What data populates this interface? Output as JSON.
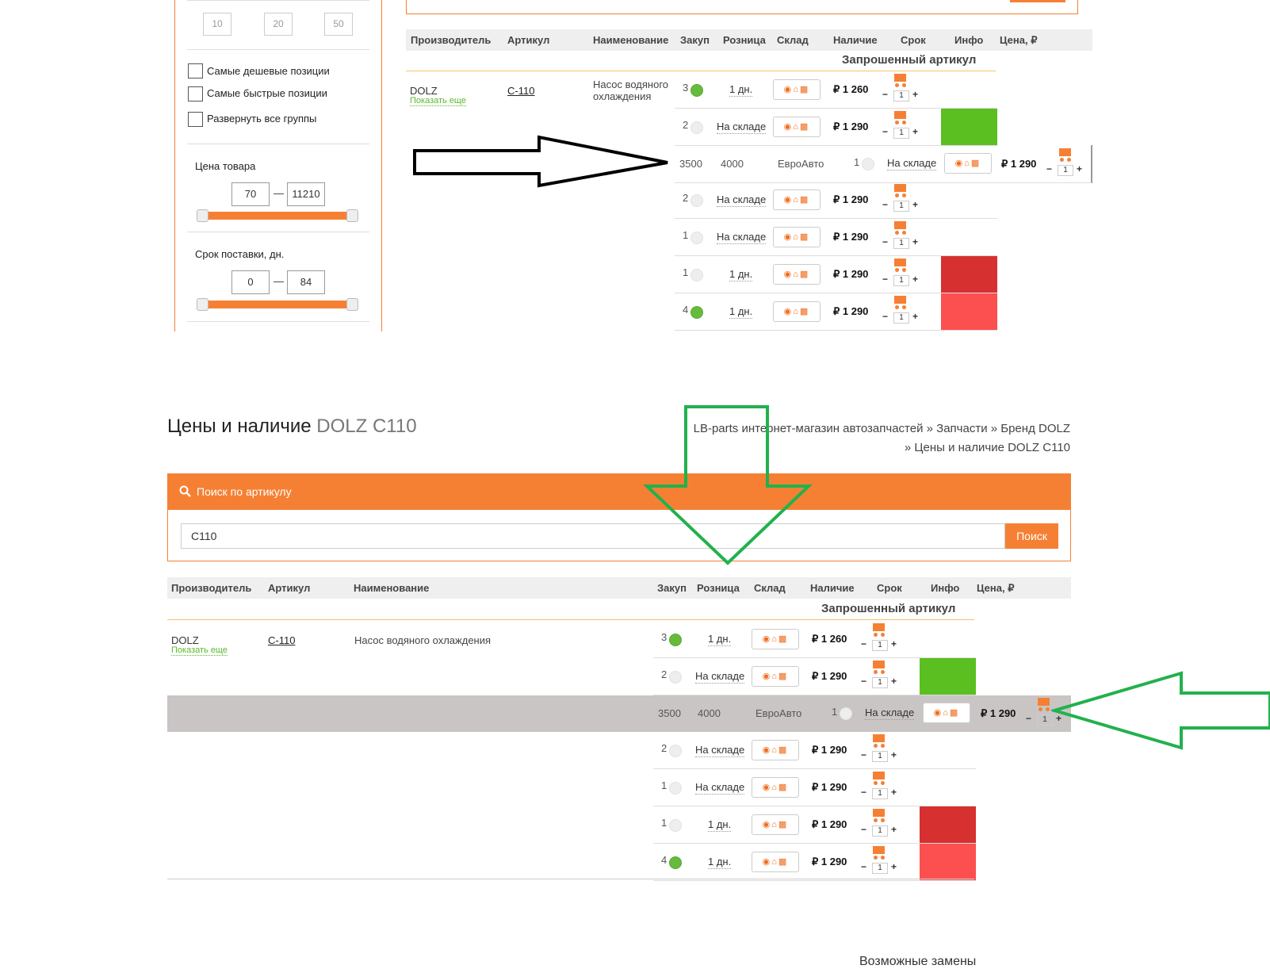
{
  "sidebar": {
    "per_page": [
      "10",
      "20",
      "50"
    ],
    "checkboxes": [
      "Самые дешевые позиции",
      "Самые быстрые позиции",
      "Развернуть все группы"
    ],
    "price": {
      "title": "Цена товара",
      "from": "70",
      "to": "11210"
    },
    "delivery": {
      "title": "Срок поставки, дн.",
      "from": "0",
      "to": "84"
    },
    "dash": "—"
  },
  "table": {
    "columns_top": [
      "Производитель",
      "Артикул",
      "Наименование",
      "Закуп",
      "Розница",
      "Склад",
      "Наличие",
      "Срок",
      "Инфо",
      "Цена, ₽"
    ],
    "columns_bottom": [
      "Производитель",
      "Артикул",
      "Наименование",
      "Закуп",
      "Розница",
      "Склад",
      "Наличие",
      "Срок",
      "Инфо",
      "Цена, ₽"
    ],
    "requested_title": "Запрошенный артикул",
    "manufacturer": "DOLZ",
    "show_more": "Показать еще",
    "article": "C-110",
    "name": "Насос водяного охлаждения",
    "rows": [
      {
        "qty": "3",
        "dot": "green",
        "delivery": "1 дн.",
        "price": "₽ 1 260",
        "count": "1",
        "color": ""
      },
      {
        "qty": "2",
        "dot": "grey",
        "delivery": "На складе",
        "price": "₽ 1 290",
        "count": "1",
        "color": "#5bbf21"
      },
      {
        "qty": "2",
        "dot": "grey",
        "delivery": "На складе",
        "price": "₽ 1 290",
        "count": "1",
        "color": ""
      },
      {
        "qty": "1",
        "dot": "grey",
        "delivery": "На складе",
        "price": "₽ 1 290",
        "count": "1",
        "color": ""
      },
      {
        "qty": "1",
        "dot": "grey",
        "delivery": "1 дн.",
        "price": "₽ 1 290",
        "count": "1",
        "color": "#d63031"
      },
      {
        "qty": "4",
        "dot": "green",
        "delivery": "1 дн.",
        "price": "₽ 1 290",
        "count": "1",
        "color": "#fc4f4f"
      }
    ],
    "highlight_row": {
      "buy": "3500",
      "retail": "4000",
      "warehouse": "ЕвроАвто",
      "qty": "1",
      "delivery": "На складе",
      "price": "₽ 1 290",
      "count": "1"
    }
  },
  "page": {
    "title_main": "Цены и наличие",
    "title_brand": "DOLZ C110",
    "breadcrumb_line1": "LB-parts интернет-магазин автозапчастей » Запчасти » Бренд DOLZ",
    "breadcrumb_line2": "» Цены и наличие DOLZ C110",
    "search_title": "Поиск по артикулу",
    "search_value": "C110",
    "search_button": "Поиск",
    "replacements_title": "Возможные замены"
  },
  "stepper": {
    "minus": "−",
    "plus": "+"
  },
  "colors": {
    "accent": "#f58034",
    "green_marker": "#5bbf21",
    "red_marker": "#d63031",
    "light_red_marker": "#fc4f4f",
    "highlight_bg": "#c9c5c5",
    "black_arrow": "#000000",
    "green_arrow": "#22b14c"
  }
}
